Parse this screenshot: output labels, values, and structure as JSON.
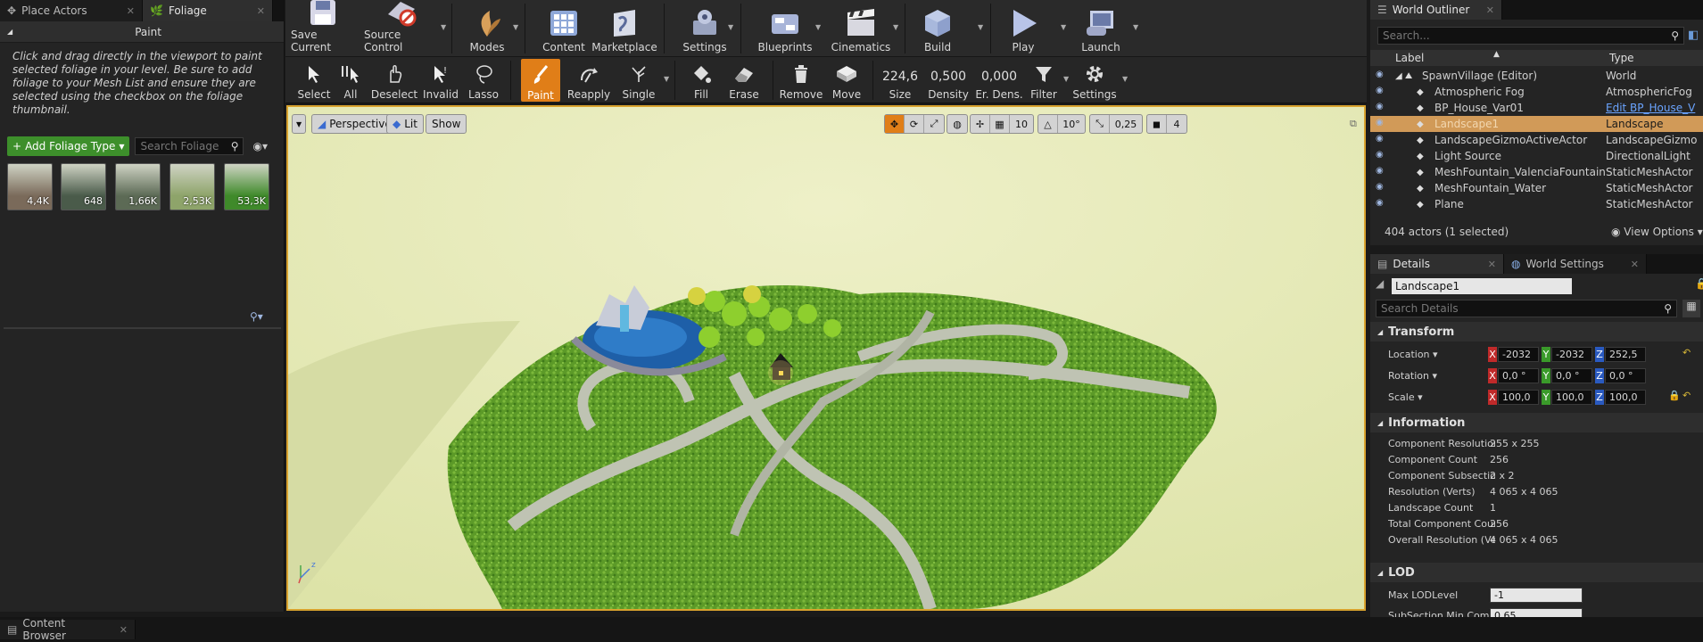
{
  "left_panel": {
    "tabs": [
      {
        "label": "Place Actors",
        "icon": "place-actors-icon"
      },
      {
        "label": "Foliage",
        "icon": "foliage-icon"
      }
    ],
    "paint_header": "Paint",
    "paint_info": "Click and drag directly in the viewport to paint selected foliage in your level. Be sure to add foliage to your Mesh List and ensure they are selected using the checkbox on the foliage thumbnail.",
    "add_foliage_label": "Add Foliage Type",
    "search_placeholder": "Search Foliage",
    "foliage_thumbnails": [
      {
        "count": "4,4K",
        "color": "#7a6a5a"
      },
      {
        "count": "648",
        "color": "#4a5b4a"
      },
      {
        "count": "1,66K",
        "color": "#5c6a55"
      },
      {
        "count": "2,53K",
        "color": "#8ea46a"
      },
      {
        "count": "53,3K",
        "color": "#3f8a2a"
      }
    ]
  },
  "main_toolbar": [
    {
      "label": "Save Current",
      "icon": "save-icon"
    },
    {
      "label": "Source Control",
      "icon": "source-control-icon"
    },
    {
      "label": "Modes",
      "icon": "modes-icon"
    },
    {
      "label": "Content",
      "icon": "content-icon"
    },
    {
      "label": "Marketplace",
      "icon": "marketplace-icon"
    },
    {
      "label": "Settings",
      "icon": "settings-icon"
    },
    {
      "label": "Blueprints",
      "icon": "blueprints-icon"
    },
    {
      "label": "Cinematics",
      "icon": "cinematics-icon"
    },
    {
      "label": "Build",
      "icon": "build-icon"
    },
    {
      "label": "Play",
      "icon": "play-icon"
    },
    {
      "label": "Launch",
      "icon": "launch-icon"
    }
  ],
  "foliage_toolbar": {
    "tools": [
      {
        "label": "Select",
        "icon": "select-icon"
      },
      {
        "label": "All",
        "icon": "select-all-icon"
      },
      {
        "label": "Deselect",
        "icon": "deselect-icon"
      },
      {
        "label": "Invalid",
        "icon": "invalid-icon"
      },
      {
        "label": "Lasso",
        "icon": "lasso-icon"
      },
      {
        "label": "Paint",
        "icon": "paint-icon"
      },
      {
        "label": "Reapply",
        "icon": "reapply-icon"
      },
      {
        "label": "Single",
        "icon": "single-icon"
      },
      {
        "label": "Fill",
        "icon": "fill-icon"
      },
      {
        "label": "Erase",
        "icon": "erase-icon"
      },
      {
        "label": "Remove",
        "icon": "remove-icon"
      },
      {
        "label": "Move",
        "icon": "move-icon"
      }
    ],
    "size_value": "224,6",
    "size_label": "Size",
    "density_value": "0,500",
    "density_label": "Density",
    "erase_density_value": "0,000",
    "erase_density_label": "Er. Dens.",
    "filter_label": "Filter",
    "settings_label": "Settings"
  },
  "viewport": {
    "perspective_label": "Perspective",
    "lit_label": "Lit",
    "show_label": "Show",
    "grid_snap": "10",
    "rotation_snap": "10°",
    "scale_snap": "0,25",
    "camera_speed": "4"
  },
  "world_outliner": {
    "tab_label": "World Outliner",
    "search_placeholder": "Search...",
    "columns": {
      "label": "Label",
      "type": "Type"
    },
    "rows": [
      {
        "label": "SpawnVillage (Editor)",
        "type": "World"
      },
      {
        "label": "Atmospheric Fog",
        "type": "AtmosphericFog"
      },
      {
        "label": "BP_House_Var01",
        "type": "Edit BP_House_V"
      },
      {
        "label": "Landscape1",
        "type": "Landscape"
      },
      {
        "label": "LandscapeGizmoActiveActor",
        "type": "LandscapeGizmo"
      },
      {
        "label": "Light Source",
        "type": "DirectionalLight"
      },
      {
        "label": "MeshFountain_ValenciaFountain",
        "type": "StaticMeshActor"
      },
      {
        "label": "MeshFountain_Water",
        "type": "StaticMeshActor"
      },
      {
        "label": "Plane",
        "type": "StaticMeshActor"
      }
    ],
    "selected_index": 3,
    "status": "404 actors (1 selected)",
    "view_options": "View Options"
  },
  "details": {
    "tabs": [
      "Details",
      "World Settings"
    ],
    "actor_name": "Landscape1",
    "search_placeholder": "Search Details",
    "transform_header": "Transform",
    "location": {
      "label": "Location",
      "x": "-2032",
      "y": "-2032",
      "z": "252,5"
    },
    "rotation": {
      "label": "Rotation",
      "x": "0,0 °",
      "y": "0,0 °",
      "z": "0,0 °"
    },
    "scale": {
      "label": "Scale",
      "x": "100,0",
      "y": "100,0",
      "z": "100,0"
    },
    "information_header": "Information",
    "information": [
      {
        "key": "Component Resolution",
        "value": "255 x 255"
      },
      {
        "key": "Component Count",
        "value": "256"
      },
      {
        "key": "Component Subsections",
        "value": "2 x 2"
      },
      {
        "key": "Resolution (Verts)",
        "value": "4 065 x 4 065"
      },
      {
        "key": "Landscape Count",
        "value": "1"
      },
      {
        "key": "Total Component Count",
        "value": "256"
      },
      {
        "key": "Overall Resolution (Verts)",
        "value": "4 065 x 4 065"
      }
    ],
    "lod_header": "LOD",
    "max_lod": {
      "label": "Max LODLevel",
      "value": "-1"
    },
    "subsection_min": {
      "label": "SubSection Min Comp",
      "value": "0,65"
    }
  },
  "bottom": {
    "content_browser_tab": "Content Browser"
  }
}
